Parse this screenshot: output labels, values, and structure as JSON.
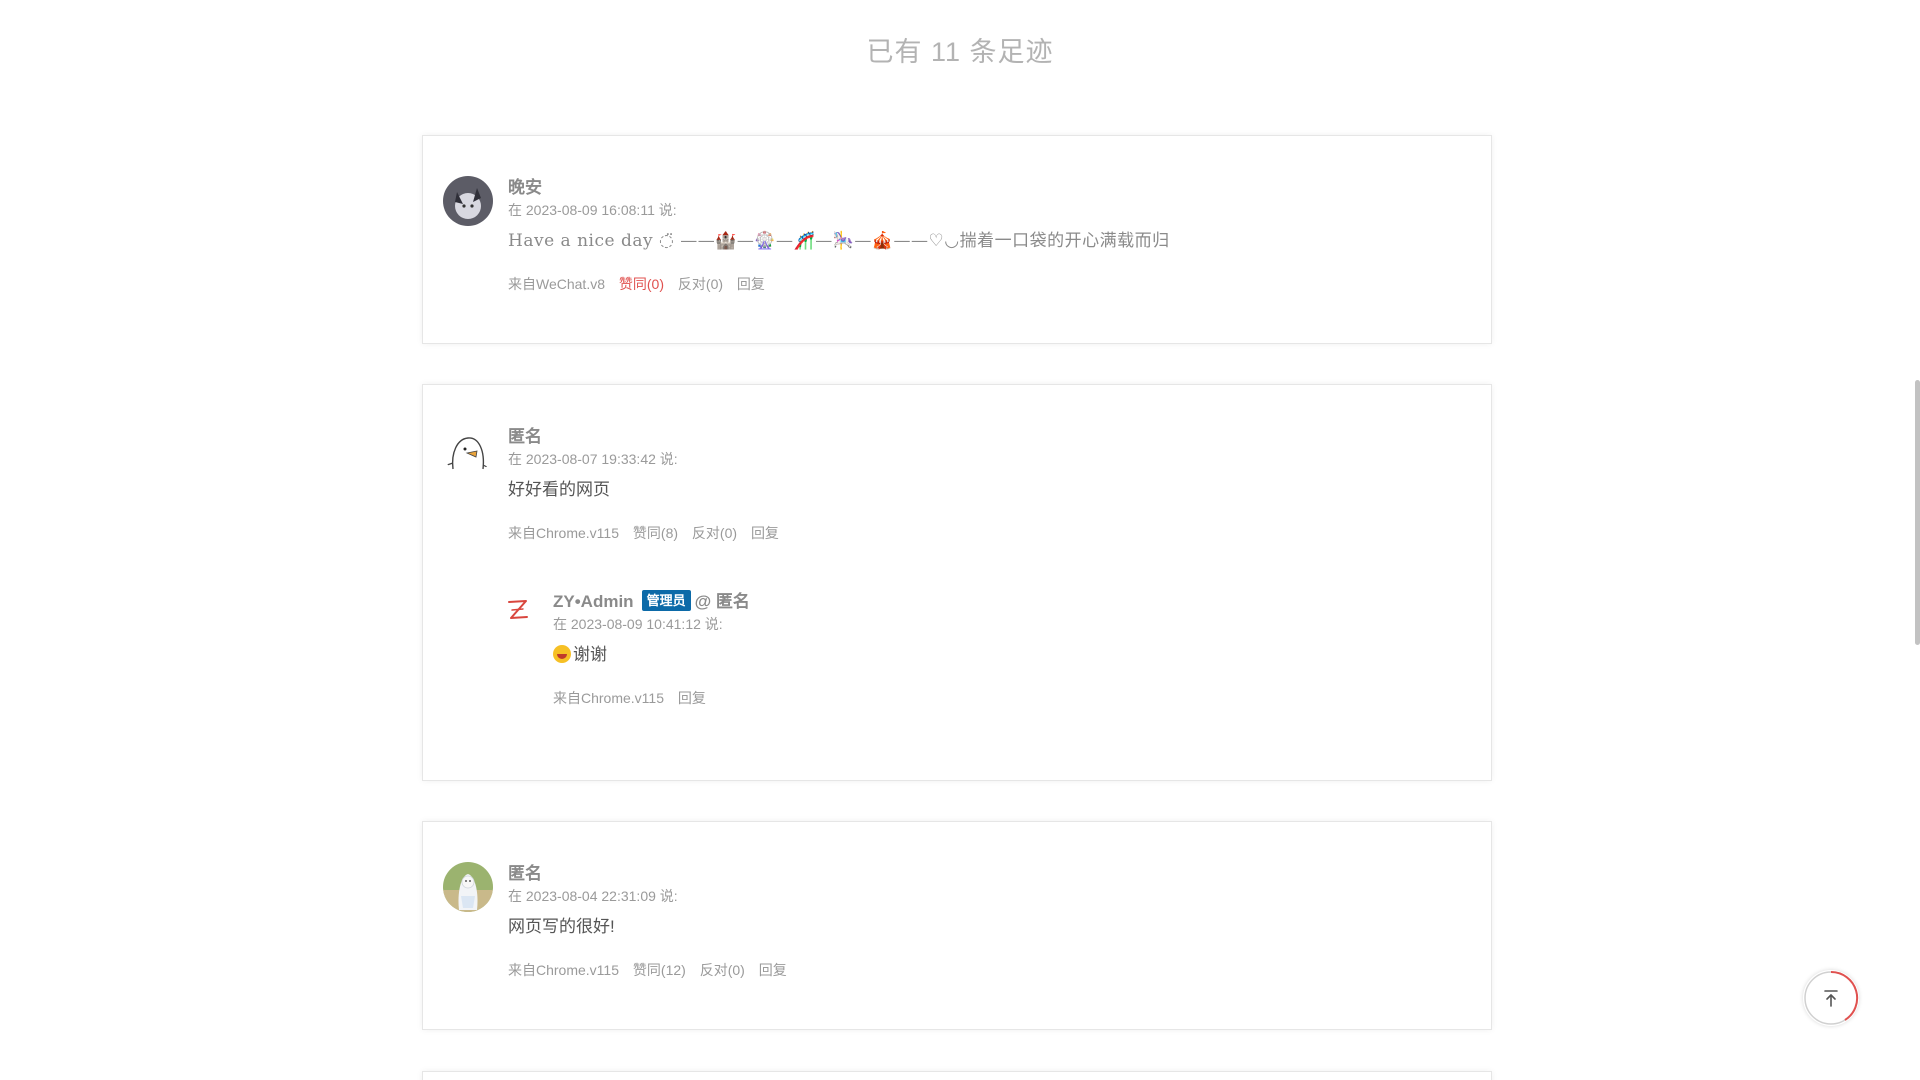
{
  "header": {
    "title": "已有 11 条足迹"
  },
  "comments": [
    {
      "name": "晚安",
      "meta": "在 2023-08-09 16:08:11 说:",
      "text": "Have a nice day ◌̈ ——🏰—🎡—🎢—🎠—🎪——♡◡揣着一口袋的开心满载而归",
      "source": "来自WeChat.v8",
      "like": "赞同(0)",
      "dislike": "反对(0)",
      "reply": "回复"
    },
    {
      "name": "匿名",
      "meta": "在 2023-08-07 19:33:42 说:",
      "text": "好好看的网页",
      "source": "来自Chrome.v115",
      "like": "赞同(8)",
      "dislike": "反对(0)",
      "reply": "回复",
      "replies": [
        {
          "name": "ZY•Admin",
          "badge": "管理员",
          "at": "@ 匿名",
          "meta": "在 2023-08-09 10:41:12 说:",
          "text": "谢谢",
          "emoji": "grinning-face",
          "source": "来自Chrome.v115",
          "reply": "回复"
        }
      ]
    },
    {
      "name": "匿名",
      "meta": "在 2023-08-04 22:31:09 说:",
      "text": "网页写的很好!",
      "source": "来自Chrome.v115",
      "like": "赞同(12)",
      "dislike": "反对(0)",
      "reply": "回复"
    }
  ],
  "back_to_top": {
    "icon": "arrow-up-to-top-icon"
  },
  "colors": {
    "liked": "#e0514f",
    "badge": "#0c6aa8",
    "progress_ring": "#e0514f"
  }
}
